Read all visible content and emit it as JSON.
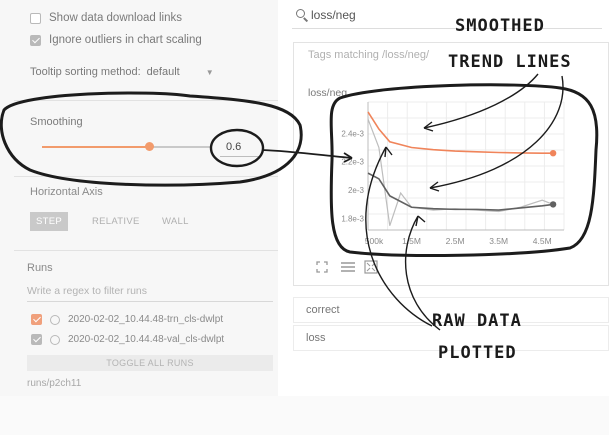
{
  "left_panel": {
    "options": {
      "show_download_links": "Show data download links",
      "ignore_outliers": "Ignore outliers in chart scaling",
      "tooltip_sorting_label": "Tooltip sorting method:",
      "tooltip_sorting_value": "default"
    },
    "smoothing": {
      "title": "Smoothing",
      "value": "0.6",
      "fraction": 0.6
    },
    "horizontal_axis": {
      "title": "Horizontal Axis",
      "buttons": [
        "STEP",
        "RELATIVE",
        "WALL"
      ]
    },
    "runs": {
      "title": "Runs",
      "filter_placeholder": "Write a regex to filter runs",
      "items": [
        {
          "label": "2020-02-02_10.44.48-trn_cls-dwlpt",
          "checked": true
        },
        {
          "label": "2020-02-02_10.44.48-val_cls-dwlpt",
          "checked": true
        }
      ],
      "toggle_all": "TOGGLE ALL RUNS",
      "directory": "runs/p2ch11"
    }
  },
  "right_panel": {
    "search_value": "loss/neg",
    "tags_matching": "Tags matching /loss/neg/",
    "card_title": "loss/neg",
    "other_sections": [
      "correct",
      "loss"
    ]
  },
  "annotations": {
    "smoothed": [
      "SMOOTHED",
      "TREND LINES"
    ],
    "raw": [
      "RAW DATA",
      "PLOTTED"
    ]
  },
  "colors": {
    "accent": "#f0845a",
    "raw_line": "#9e9e9e",
    "smoothed_gray": "#616161"
  },
  "chart_data": {
    "type": "line",
    "title": "loss/neg",
    "x_ticks": [
      "1.5M",
      "2.5M",
      "3.5M",
      "4.5M"
    ],
    "x_ticks_partial": "500k",
    "y_ticks": [
      "2.4e-3",
      "2.2e-3",
      "2e-3",
      "1.8e-3"
    ],
    "x_range": [
      0.5,
      5.0
    ],
    "series": [
      {
        "name": "",
        "color": "#f0845a",
        "x": [
          0.5,
          0.75,
          1.0,
          1.5,
          2.0,
          2.5,
          3.0,
          3.5,
          4.0,
          4.5,
          4.75
        ],
        "y": [
          2.55,
          2.43,
          2.34,
          2.3,
          2.285,
          2.275,
          2.27,
          2.265,
          2.262,
          2.26,
          2.26
        ]
      },
      {
        "name": "",
        "color": "#616161",
        "x": [
          0.5,
          0.75,
          1.0,
          1.5,
          2.0,
          2.5,
          3.0,
          3.5,
          4.0,
          4.5,
          4.75
        ],
        "y": [
          2.12,
          2.08,
          1.96,
          1.88,
          1.87,
          1.865,
          1.865,
          1.86,
          1.875,
          1.89,
          1.9
        ]
      },
      {
        "name": "",
        "color": "#bdbdbd",
        "x": [
          0.5,
          0.75,
          1.0,
          1.25,
          1.5,
          2.0,
          2.5,
          3.0,
          3.5,
          4.0,
          4.5,
          4.75
        ],
        "y": [
          2.5,
          2.3,
          1.75,
          1.98,
          1.88,
          1.86,
          1.87,
          1.86,
          1.85,
          1.88,
          1.93,
          1.9
        ]
      }
    ]
  }
}
